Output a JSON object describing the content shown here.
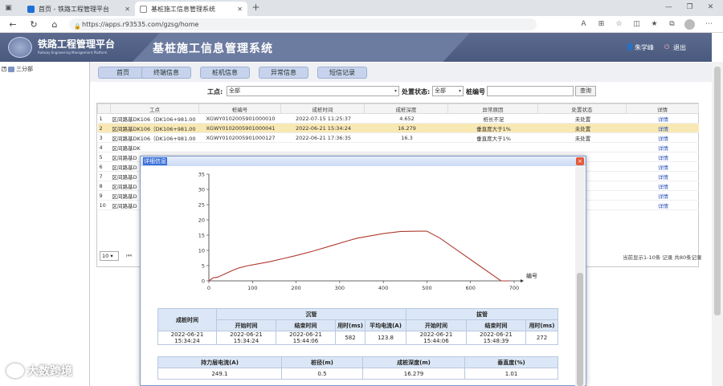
{
  "browser": {
    "tabs": [
      {
        "label": "首页 - 铁路工程管理平台",
        "active": false
      },
      {
        "label": "基桩施工信息管理系统",
        "active": true
      }
    ],
    "url": "https://apps.r93535.com/gzsg/home"
  },
  "header": {
    "app_name": "铁路工程管理平台",
    "app_name_en": "Railway Engineering Management Platform",
    "system_title": "基桩施工信息管理系统",
    "user": "朱学峰",
    "logout": "退出"
  },
  "sidebar": {
    "root": "三分部"
  },
  "menu": [
    "首页",
    "终端信息",
    "桩机信息",
    "异常信息",
    "短信记录"
  ],
  "filters": {
    "site_label": "工点:",
    "site_value": "全部",
    "status_label": "处置状态:",
    "status_value": "全部",
    "pile_label": "桩编号",
    "pile_value": "",
    "search_label": "查询"
  },
  "grid": {
    "columns": [
      "",
      "工点",
      "桩编号",
      "成桩时间",
      "成桩深度",
      "异常原因",
      "处置状态",
      "详情"
    ],
    "rows": [
      {
        "n": "1",
        "site": "区间路基DK106（DK106+981.00",
        "pile": "XGWY0102005901000010",
        "time": "2022-07-15 11:25:37",
        "depth": "4.652",
        "reason": "桩长不足",
        "status": "未处置",
        "link": "详情"
      },
      {
        "n": "2",
        "site": "区间路基DK106（DK106+981.00",
        "pile": "XGWY0102005901000041",
        "time": "2022-06-21 15:34:24",
        "depth": "16.279",
        "reason": "垂直度大于1%",
        "status": "未处置",
        "link": "详情"
      },
      {
        "n": "3",
        "site": "区间路基DK106（DK106+981.00",
        "pile": "XGWY0102005901000127",
        "time": "2022-06-21 17:36:35",
        "depth": "16.3",
        "reason": "垂直度大于1%",
        "status": "未处置",
        "link": "详情"
      },
      {
        "n": "4",
        "site": "区间路基DK",
        "pile": "",
        "time": "",
        "depth": "",
        "reason": "",
        "status": "",
        "link": "详情"
      },
      {
        "n": "5",
        "site": "区间路基D",
        "pile": "",
        "time": "",
        "depth": "",
        "reason": "",
        "status": "",
        "link": "详情"
      },
      {
        "n": "6",
        "site": "区间路基D",
        "pile": "",
        "time": "",
        "depth": "",
        "reason": "",
        "status": "",
        "link": "详情"
      },
      {
        "n": "7",
        "site": "区间路基D",
        "pile": "",
        "time": "",
        "depth": "",
        "reason": "",
        "status": "",
        "link": "详情"
      },
      {
        "n": "8",
        "site": "区间路基D",
        "pile": "",
        "time": "",
        "depth": "",
        "reason": "",
        "status": "",
        "link": "详情"
      },
      {
        "n": "9",
        "site": "区间路基D",
        "pile": "",
        "time": "",
        "depth": "",
        "reason": "",
        "status": "",
        "link": "详情"
      },
      {
        "n": "10",
        "site": "区间路基D",
        "pile": "",
        "time": "",
        "depth": "",
        "reason": "",
        "status": "",
        "link": "详情"
      }
    ],
    "selected_row": 1
  },
  "pager": {
    "page_size": "10",
    "info": "当前显示1-10条 记录 共80条记录"
  },
  "modal": {
    "title": "详细信息",
    "close": "×",
    "info1": {
      "pile_time_label": "成桩时间",
      "sink_label": "沉管",
      "pull_label": "拔管",
      "sub_headers": [
        "开始时间",
        "结束时间",
        "用时(ms)",
        "平均电流(A)",
        "开始时间",
        "结束时间",
        "用时(ms)"
      ],
      "values": [
        "2022-06-21 15:34:24",
        "2022-06-21 15:34:24",
        "2022-06-21 15:44:06",
        "582",
        "123.8",
        "2022-06-21 15:44:06",
        "2022-06-21 15:48:39",
        "272"
      ]
    },
    "info2": {
      "headers": [
        "持力层电流(A)",
        "桩径(m)",
        "成桩深度(m)",
        "垂直度(%)"
      ],
      "values": [
        "249.1",
        "0.5",
        "16.279",
        "1.01"
      ]
    }
  },
  "chart_data": {
    "type": "line",
    "title": "",
    "xlabel": "编号",
    "ylabel": "",
    "xlim": [
      0,
      700
    ],
    "ylim": [
      0,
      35
    ],
    "x_ticks": [
      0,
      100,
      200,
      300,
      400,
      500,
      600,
      700
    ],
    "y_ticks": [
      0,
      5,
      10,
      15,
      20,
      25,
      30,
      35
    ],
    "series": [
      {
        "color": "#b03a2e",
        "x": [
          0,
          10,
          20,
          40,
          55,
          70,
          90,
          110,
          140,
          170,
          200,
          240,
          280,
          320,
          340,
          360,
          400,
          440,
          480,
          500,
          530,
          580,
          620,
          660,
          670,
          690
        ],
        "y": [
          0,
          1,
          1.2,
          2.5,
          3.5,
          4.3,
          5,
          5.5,
          6.3,
          7.3,
          8.3,
          9.8,
          11.5,
          13.2,
          14,
          14.5,
          15.5,
          16.2,
          16.3,
          16.3,
          14,
          9,
          5,
          1,
          0,
          0
        ]
      }
    ]
  },
  "watermark": "大数跨境",
  "colors": {
    "accent": "#5b6a8e",
    "selected_row": "#f8e8b4",
    "line": "#b03a2e"
  }
}
